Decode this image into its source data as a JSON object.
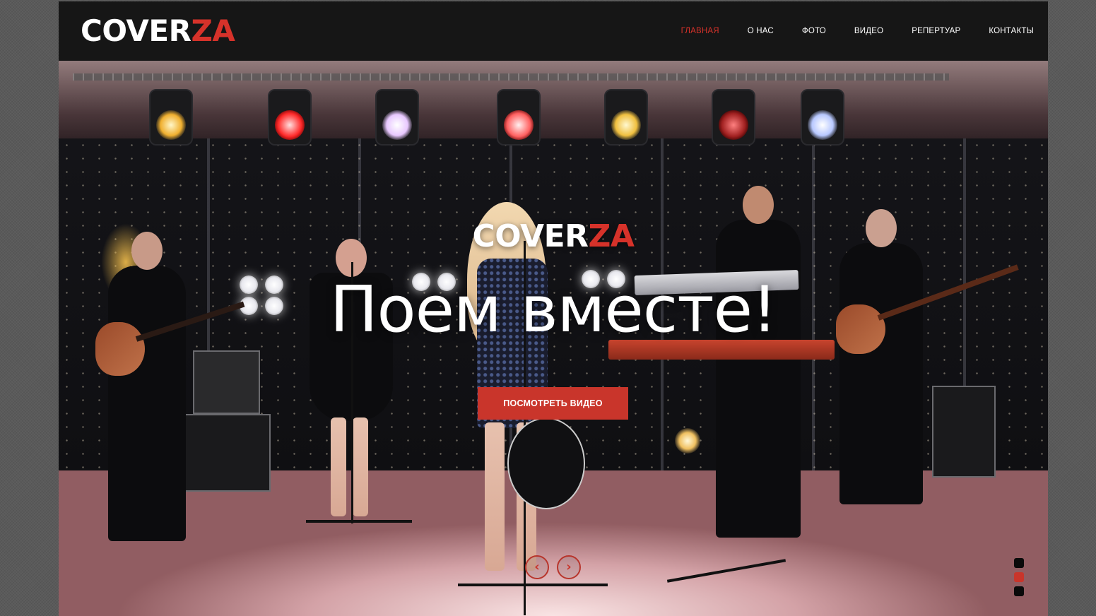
{
  "header": {
    "logo": {
      "part1": "COVER",
      "part2": "ZA"
    },
    "nav": [
      {
        "label": "ГЛАВНАЯ",
        "active": true
      },
      {
        "label": "О НАС",
        "active": false
      },
      {
        "label": "ФОТО",
        "active": false
      },
      {
        "label": "ВИДЕО",
        "active": false
      },
      {
        "label": "РЕПЕРТУАР",
        "active": false
      },
      {
        "label": "КОНТАКТЫ",
        "active": false
      }
    ]
  },
  "hero": {
    "logo": {
      "part1": "COVER",
      "part2": "ZA"
    },
    "title": "Поем вместе!",
    "cta_label": "ПОСМОТРЕТЬ ВИДЕО",
    "prev_icon": "chevron-left-icon",
    "next_icon": "chevron-right-icon",
    "prev_glyph": "‹",
    "next_glyph": "›",
    "slides_count": 3,
    "active_slide": 2
  },
  "colors": {
    "accent": "#d6322a",
    "header_bg": "#161616",
    "page_bg": "#5a5a5a"
  }
}
